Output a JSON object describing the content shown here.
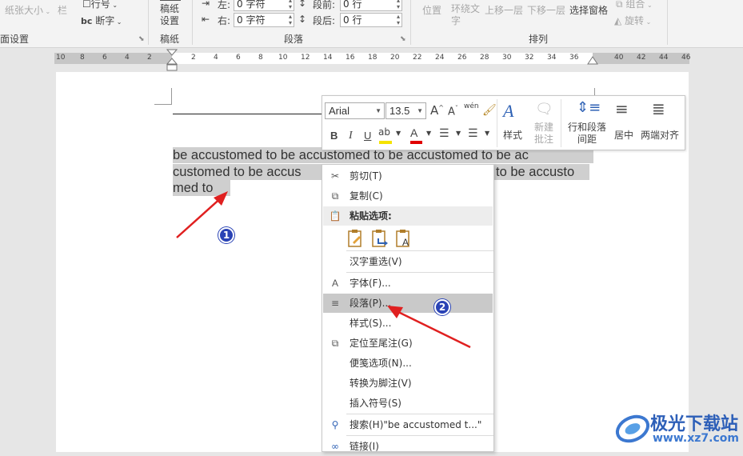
{
  "ribbon": {
    "page_setup": {
      "paper_size": "纸张大小",
      "columns": "栏",
      "line_numbers": "行号",
      "hyphenation": "断字",
      "group_label": "面设置"
    },
    "manuscript": {
      "button": "稿纸设置",
      "group_label": "稿纸"
    },
    "paragraph": {
      "indent_left_label": "左:",
      "indent_left_value": "0 字符",
      "indent_right_label": "右:",
      "indent_right_value": "0 字符",
      "spacing_before_label": "段前:",
      "spacing_before_value": "0 行",
      "spacing_after_label": "段后:",
      "spacing_after_value": "0 行",
      "group_label": "段落"
    },
    "arrange": {
      "position": "位置",
      "wrap_text": "环绕文字",
      "bring_forward": "上移一层",
      "send_backward": "下移一层",
      "selection_pane": "选择窗格",
      "group": "组合",
      "rotate": "旋转",
      "group_label": "排列"
    }
  },
  "ruler": {
    "left_ticks": [
      "10",
      "8",
      "6",
      "4",
      "2"
    ],
    "right_ticks": [
      "2",
      "4",
      "6",
      "8",
      "10",
      "12",
      "14",
      "16",
      "18",
      "20",
      "22",
      "24",
      "26",
      "28",
      "30",
      "32",
      "34",
      "36",
      "40",
      "42",
      "44",
      "46"
    ]
  },
  "document": {
    "lines": [
      "be  accustomed  to  be  accustomed  to  be  accustomed  to  be  ac",
      "customed  to  be  accus",
      "med  to"
    ],
    "line2_tail": "to  be  accusto"
  },
  "mini_toolbar": {
    "font_name": "Arial",
    "font_size": "13.5",
    "grow_font": "A",
    "shrink_font": "A",
    "phonetic": "wén",
    "bold": "B",
    "italic": "I",
    "underline": "U",
    "font_color_letter": "A",
    "styles": "样式",
    "new_comment_line1": "新建",
    "new_comment_line2": "批注",
    "line_spacing_line1": "行和段落",
    "line_spacing_line2": "间距",
    "center": "居中",
    "justify": "两端对齐"
  },
  "context_menu": {
    "cut": "剪切(T)",
    "copy": "复制(C)",
    "paste_options": "粘贴选项:",
    "reconvert": "汉字重选(V)",
    "font": "字体(F)...",
    "paragraph": "段落(P)...",
    "styles": "样式(S)...",
    "go_to_endnote": "定位至尾注(G)",
    "note_options": "便笺选项(N)...",
    "convert_to_footnote": "转换为脚注(V)",
    "insert_symbol": "插入符号(S)",
    "search": "搜索(H)\"be accustomed t...\"",
    "link": "链接(I)"
  },
  "annotations": {
    "step1": "1",
    "step2": "2"
  },
  "watermark": {
    "name": "极光下载站",
    "url": "www.xz7.com"
  },
  "colors": {
    "highlight": "#f5e300",
    "font_color_bar": "#e00000",
    "arrow": "#e02020",
    "badge": "#2a43b5"
  }
}
